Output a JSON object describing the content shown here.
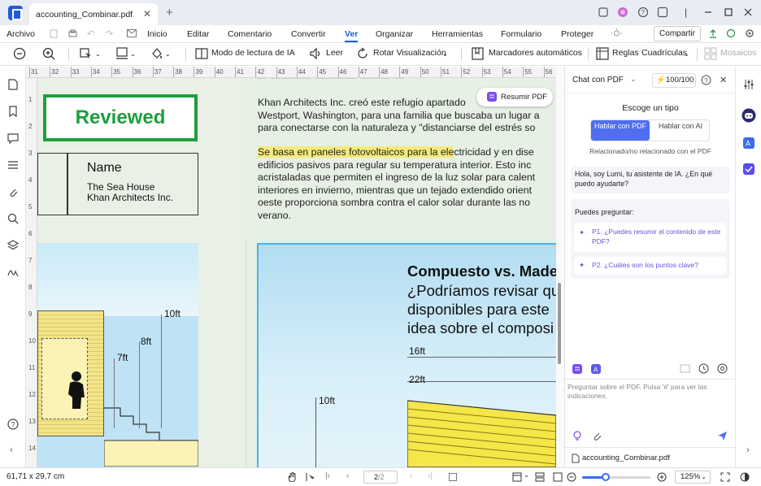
{
  "titlebar": {
    "tab_title": "accounting_Combinar.pdf",
    "close": "✕",
    "new_tab": "+"
  },
  "menu": {
    "archivo": "Archivo",
    "items": [
      "Inicio",
      "Editar",
      "Comentario",
      "Convertir",
      "Ver",
      "Organizar",
      "Herramientas",
      "Formulario",
      "Proteger"
    ],
    "active": "Ver",
    "share": "Compartir"
  },
  "toolbar": {
    "ai_read": "Modo de lectura de IA",
    "read": "Leer",
    "rotate": "Rotar Visualización",
    "bookmarks": "Marcadores automáticos",
    "rules": "Reglas",
    "grids": "Cuadrículas",
    "mosaics": "Mosaicos"
  },
  "ruler": {
    "ticks": [
      "31",
      "32",
      "33",
      "34",
      "35",
      "36",
      "37",
      "38",
      "39",
      "40",
      "41",
      "42",
      "43",
      "44",
      "45",
      "46",
      "47",
      "48",
      "49",
      "50",
      "51",
      "52",
      "53",
      "54",
      "55",
      "56"
    ],
    "vticks": [
      "1",
      "2",
      "3",
      "4",
      "5",
      "6",
      "7",
      "8",
      "9",
      "10",
      "11",
      "12",
      "13",
      "14"
    ]
  },
  "document": {
    "reviewed": "Reviewed",
    "summarize": "Resumir PDF",
    "name_label": "Name",
    "name_line1": "The Sea House",
    "name_line2": "Khan Architects Inc.",
    "para1": [
      "Khan Architects Inc. creó este refugio apartado",
      "Westport, Washington, para una familia que buscaba un lugar a",
      "para conectarse con la naturaleza y \"distanciarse del estrés so"
    ],
    "para2_highlight": "Se basa en paneles fotovoltaicos para la ele",
    "para2_rest": "ctricidad y en dise",
    "para2": [
      "edificios pasivos para regular su temperatura interior. Esto inc",
      "acristaladas que permiten el ingreso de la luz solar para calent",
      "interiores en invierno, mientras que un tejado extendido orient",
      "oeste proporciona sombra contra el calor solar durante las no",
      "verano."
    ],
    "left_dims": [
      "10ft",
      "8ft",
      "7ft"
    ],
    "heading_bold": "Compuesto vs. Made",
    "heading_lines": [
      "¿Podríamos revisar qu",
      "disponibles para este",
      "idea sobre el composi"
    ],
    "right_dims": [
      "16ft",
      "22ft",
      "10ft"
    ]
  },
  "panel": {
    "mode": "Chat con PDF",
    "credits": "100/100",
    "choose_type": "Escoge un tipo",
    "opt_pdf": "Hablar con PDF",
    "opt_ai": "Hablar con AI",
    "related": "Relacionado/no relacionado con el PDF",
    "greeting": "Hola, soy Lumi, tu asistente de IA. ¿En qué puedo ayudarte?",
    "can_ask": "Puedes preguntar:",
    "q1": "P1. ¿Puedes resumir el contenido de este PDF?",
    "q2": "P2. ¿Cuáles son los puntos clave?",
    "placeholder": "Preguntar sobre el PDF. Pulsa '#' para ver las indicaciones.",
    "file": "accounting_Combinar.pdf"
  },
  "status": {
    "size": "61,71 x 29,7 cm",
    "page": "2",
    "pages": "/2",
    "zoom": "125%",
    "zoom_level": 0.35
  },
  "colors": {
    "accent": "#1f5bdb",
    "reviewed_green": "#1e9e3e",
    "sky": "#bfe3f5",
    "yellow": "#f5ea7a"
  }
}
